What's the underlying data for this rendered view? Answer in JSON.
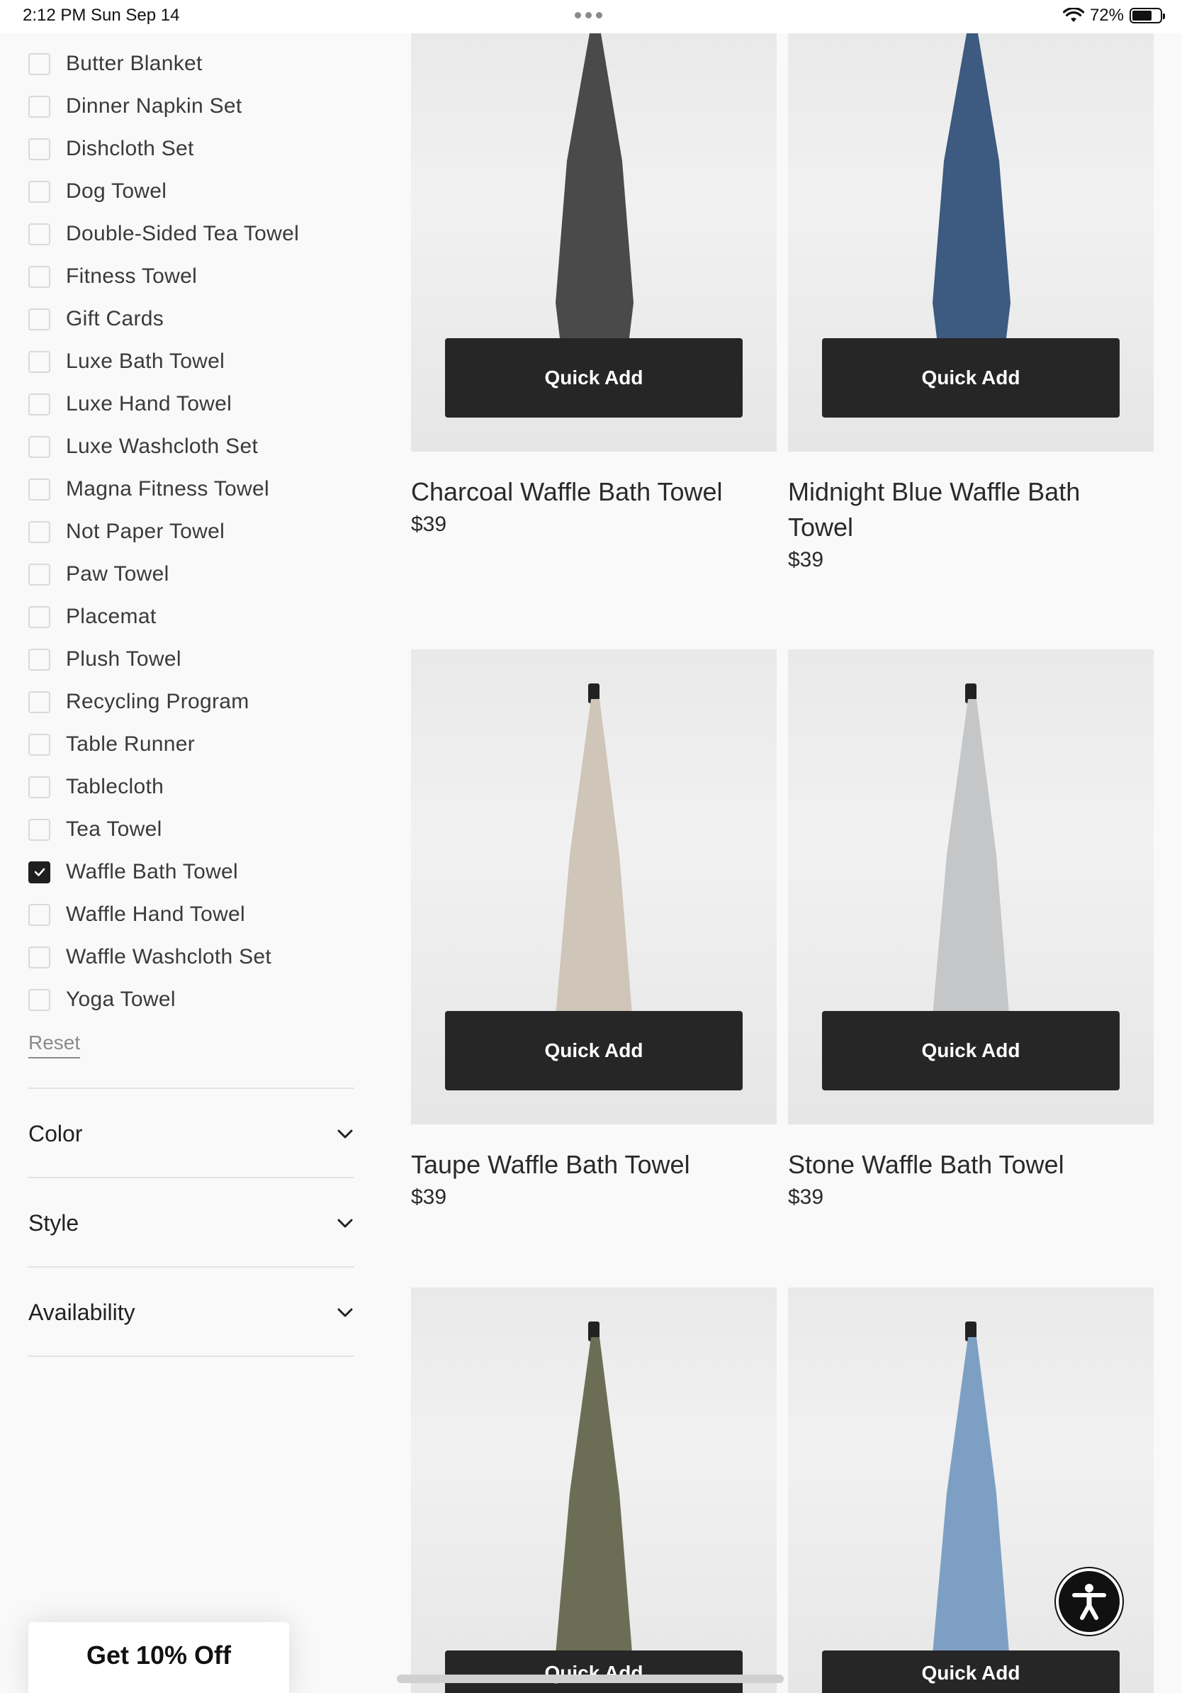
{
  "status_bar": {
    "time": "2:12 PM   Sun Sep 14",
    "battery_percent": "72%",
    "battery_level": 0.72
  },
  "filters": {
    "items": [
      {
        "label": "Butter Blanket",
        "checked": false
      },
      {
        "label": "Dinner Napkin Set",
        "checked": false
      },
      {
        "label": "Dishcloth Set",
        "checked": false
      },
      {
        "label": "Dog Towel",
        "checked": false
      },
      {
        "label": "Double-Sided Tea Towel",
        "checked": false
      },
      {
        "label": "Fitness Towel",
        "checked": false
      },
      {
        "label": "Gift Cards",
        "checked": false
      },
      {
        "label": "Luxe Bath Towel",
        "checked": false
      },
      {
        "label": "Luxe Hand Towel",
        "checked": false
      },
      {
        "label": "Luxe Washcloth Set",
        "checked": false
      },
      {
        "label": "Magna Fitness Towel",
        "checked": false
      },
      {
        "label": "Not Paper Towel",
        "checked": false
      },
      {
        "label": "Paw Towel",
        "checked": false
      },
      {
        "label": "Placemat",
        "checked": false
      },
      {
        "label": "Plush Towel",
        "checked": false
      },
      {
        "label": "Recycling Program",
        "checked": false
      },
      {
        "label": "Table Runner",
        "checked": false
      },
      {
        "label": "Tablecloth",
        "checked": false
      },
      {
        "label": "Tea Towel",
        "checked": false
      },
      {
        "label": "Waffle Bath Towel",
        "checked": true
      },
      {
        "label": "Waffle Hand Towel",
        "checked": false
      },
      {
        "label": "Waffle Washcloth Set",
        "checked": false
      },
      {
        "label": "Yoga Towel",
        "checked": false
      }
    ],
    "reset_label": "Reset"
  },
  "accordions": [
    {
      "label": "Color"
    },
    {
      "label": "Style"
    },
    {
      "label": "Availability"
    }
  ],
  "promo": {
    "label": "Get 10% Off"
  },
  "products": [
    {
      "name": "Charcoal Waffle Bath Towel",
      "price": "$39",
      "color": "#4a4a4a",
      "quick_add": "Quick Add"
    },
    {
      "name": "Midnight Blue Waffle Bath Towel",
      "price": "$39",
      "color": "#3d5a80",
      "quick_add": "Quick Add"
    },
    {
      "name": "Taupe Waffle Bath Towel",
      "price": "$39",
      "color": "#cfc5b8",
      "quick_add": "Quick Add"
    },
    {
      "name": "Stone Waffle Bath Towel",
      "price": "$39",
      "color": "#c4c6c7",
      "quick_add": "Quick Add"
    },
    {
      "name": "",
      "price": "",
      "color": "#6b6e55",
      "quick_add": "Quick Add"
    },
    {
      "name": "",
      "price": "",
      "color": "#7d9fc4",
      "quick_add": "Quick Add"
    }
  ]
}
